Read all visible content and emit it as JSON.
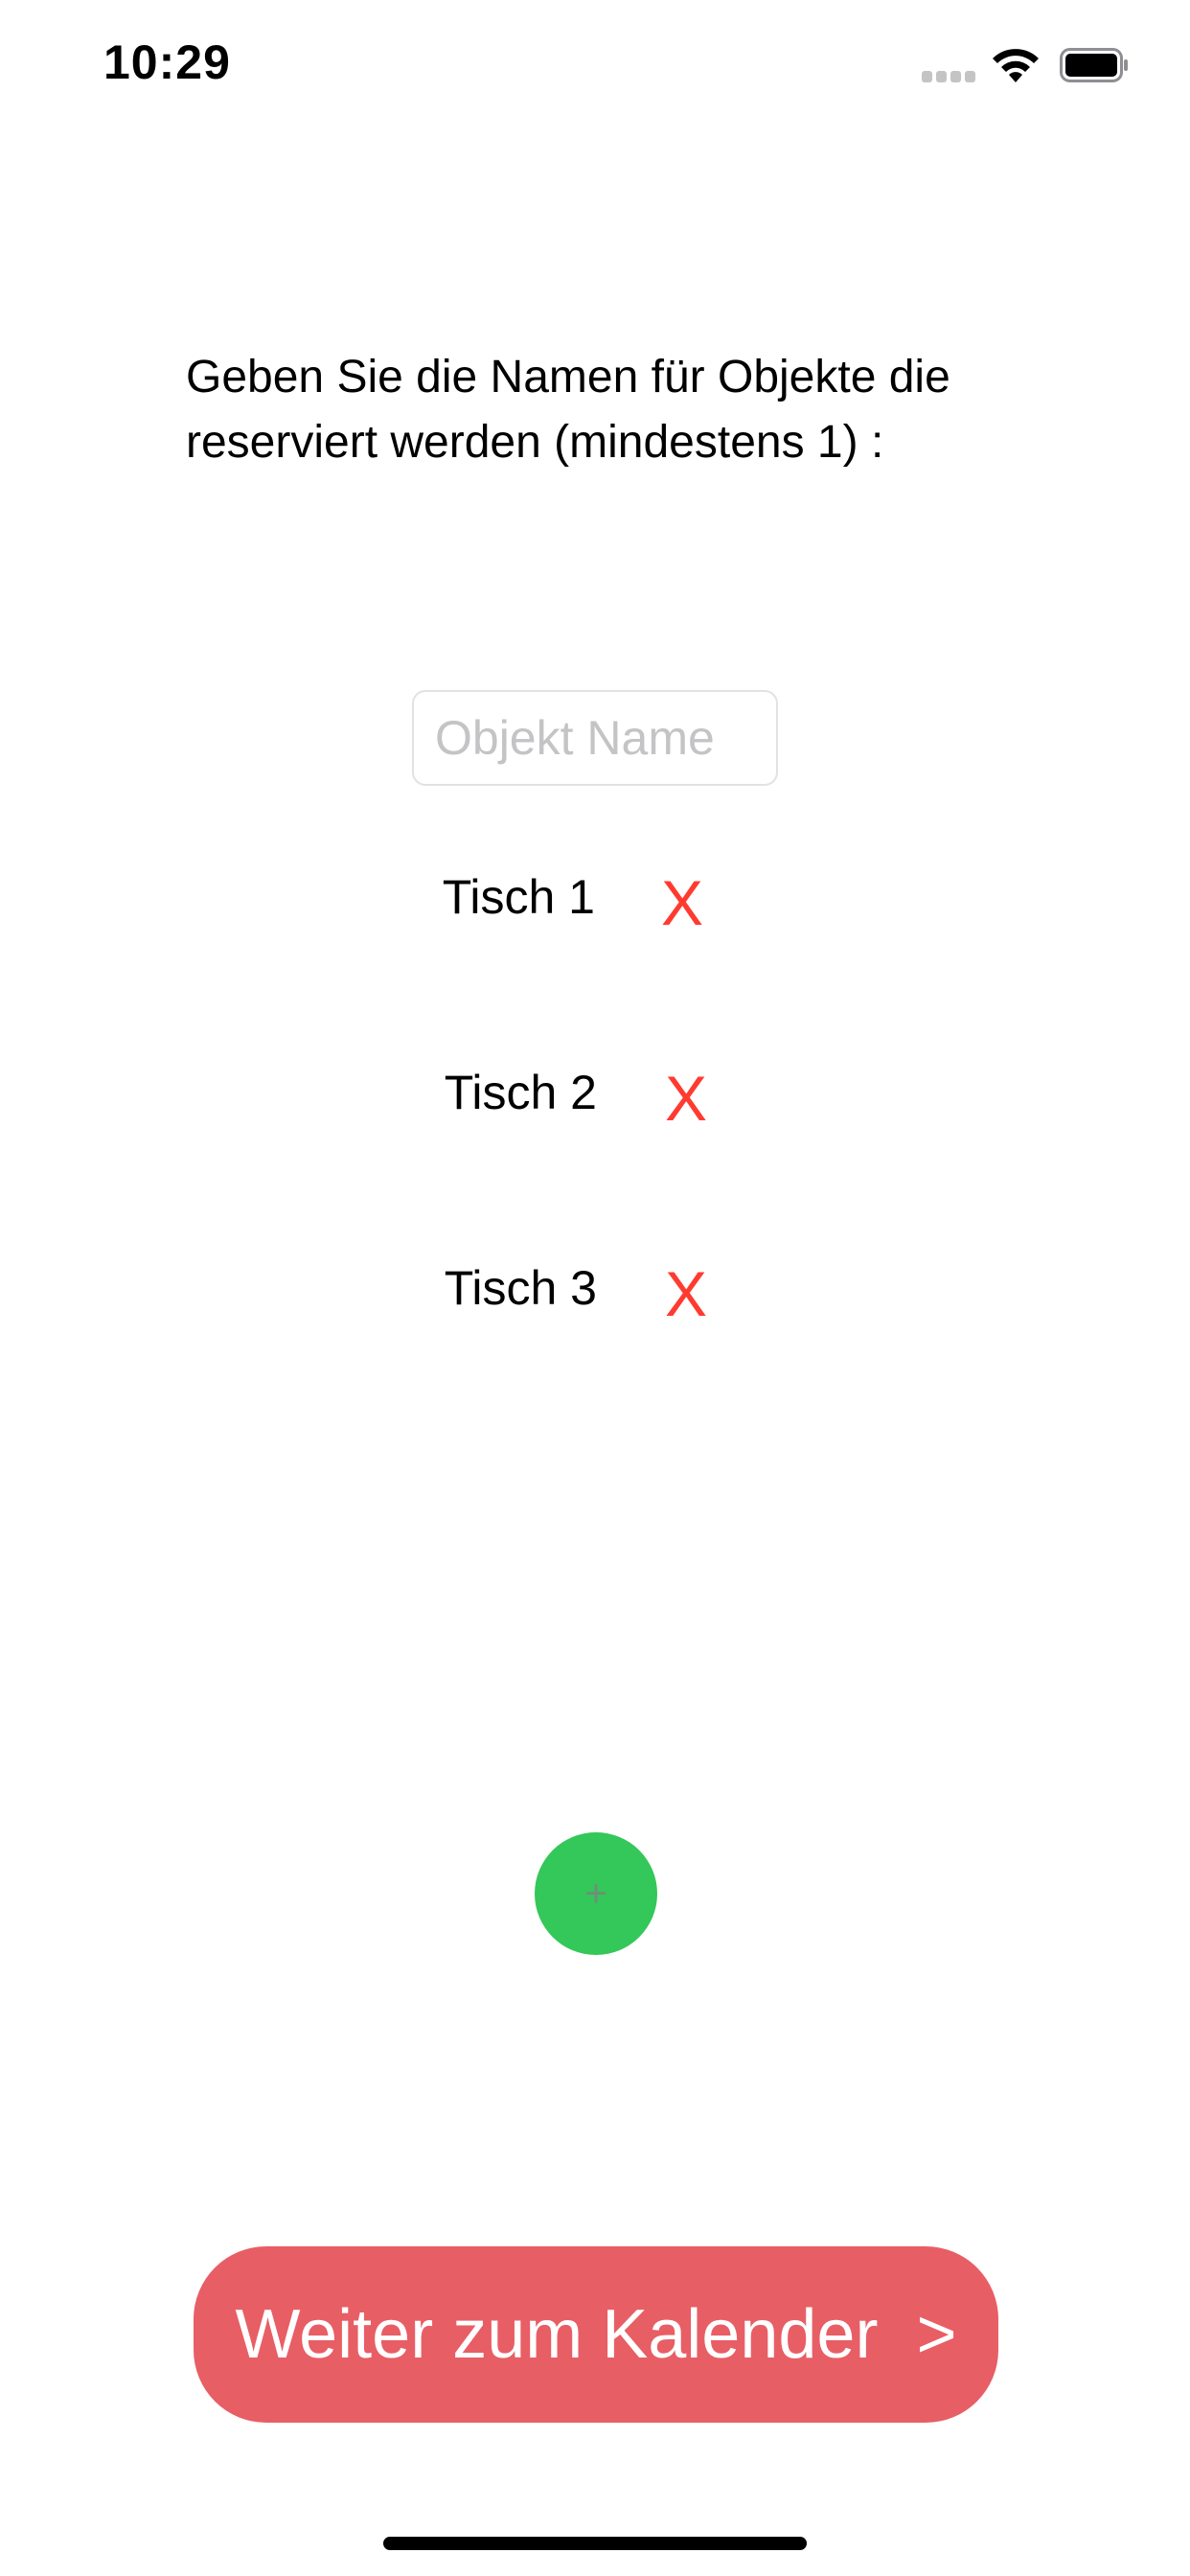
{
  "status_bar": {
    "time": "10:29",
    "signal_icon": "cellular-signal-icon",
    "wifi_icon": "wifi-icon",
    "battery_icon": "battery-icon"
  },
  "instruction": "Geben Sie die Namen für Objekte die reserviert werden (mindestens 1) :",
  "object_input": {
    "value": "",
    "placeholder": "Objekt Name"
  },
  "items": [
    {
      "label": "Tisch 1",
      "delete_label": "X"
    },
    {
      "label": "Tisch 2",
      "delete_label": "X"
    },
    {
      "label": "Tisch 3",
      "delete_label": "X"
    }
  ],
  "add_button": {
    "label": "+",
    "icon": "plus-icon"
  },
  "next_button": {
    "label": "Weiter zum Kalender",
    "chevron": ">"
  },
  "colors": {
    "delete": "#ff3b30",
    "add_button": "#34c759",
    "next_button": "#e85e65"
  }
}
